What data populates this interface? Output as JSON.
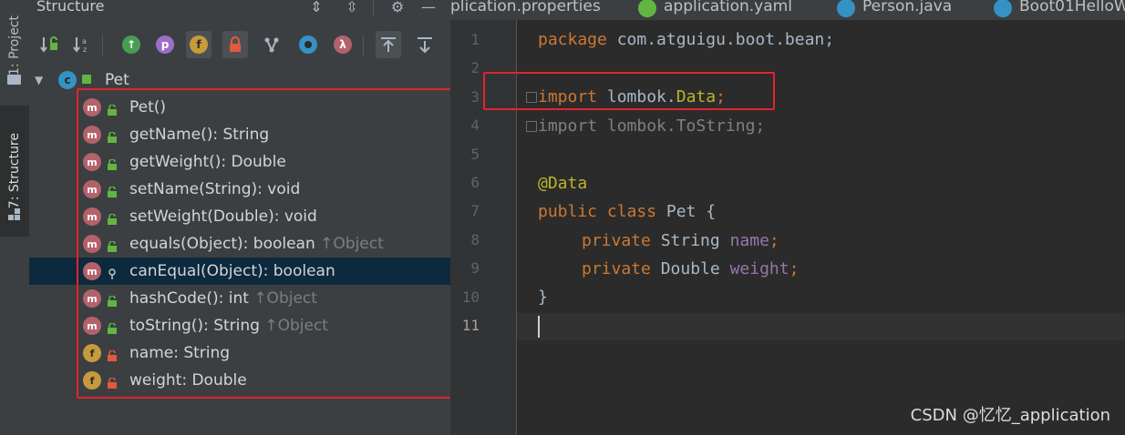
{
  "tool_strip": {
    "project_tab": "1: Project",
    "structure_tab": "7: Structure"
  },
  "structure_panel": {
    "title": "Structure",
    "header_buttons": [
      "expand-all-icon",
      "collapse-all-icon",
      "gear-icon",
      "hide-icon"
    ],
    "toolbar": [
      "sort-by-visibility",
      "sort-alphabetically",
      "show-inherited",
      "show-properties",
      "show-fields",
      "show-non-public",
      "show-lambdas",
      "show-anonymous",
      "show-circle",
      "show-lambda",
      "autoscroll-to-source",
      "autoscroll-from-source"
    ],
    "root": {
      "label": "Pet",
      "icon": "class-icon"
    },
    "members": [
      {
        "kind": "m",
        "label": "Pet()",
        "inherited": "",
        "visibility": "public"
      },
      {
        "kind": "m",
        "label": "getName(): String",
        "inherited": "",
        "visibility": "public"
      },
      {
        "kind": "m",
        "label": "getWeight(): Double",
        "inherited": "",
        "visibility": "public"
      },
      {
        "kind": "m",
        "label": "setName(String): void",
        "inherited": "",
        "visibility": "public"
      },
      {
        "kind": "m",
        "label": "setWeight(Double): void",
        "inherited": "",
        "visibility": "public"
      },
      {
        "kind": "m",
        "label": "equals(Object): boolean",
        "inherited": "↑Object",
        "visibility": "public"
      },
      {
        "kind": "m",
        "label": "canEqual(Object): boolean",
        "inherited": "",
        "visibility": "protected"
      },
      {
        "kind": "m",
        "label": "hashCode(): int",
        "inherited": "↑Object",
        "visibility": "public"
      },
      {
        "kind": "m",
        "label": "toString(): String",
        "inherited": "↑Object",
        "visibility": "public"
      },
      {
        "kind": "f",
        "label": "name: String",
        "inherited": "",
        "visibility": "private"
      },
      {
        "kind": "f",
        "label": "weight: Double",
        "inherited": "",
        "visibility": "private"
      }
    ]
  },
  "editor": {
    "tabs": [
      "plication.properties",
      "application.yaml",
      "Person.java",
      "Boot01HelloW"
    ],
    "line_numbers": [
      "1",
      "2",
      "3",
      "4",
      "5",
      "6",
      "7",
      "8",
      "9",
      "10",
      "11"
    ],
    "code": {
      "l1_kw": "package",
      "l1_rest": " com.atguigu.boot.bean;",
      "l3_kw": "import",
      "l3_pkg": " lombok.",
      "l3_cls": "Data",
      "l3_semi": ";",
      "l4": "import lombok.ToString;",
      "l6": "@Data",
      "l7_kw": "public class",
      "l7_rest": " Pet {",
      "l8_kw": "private",
      "l8_type": " String ",
      "l8_field": "name",
      "l8_semi": ";",
      "l9_kw": "private",
      "l9_type": " Double ",
      "l9_field": "weight",
      "l9_semi": ";",
      "l10": "}"
    }
  },
  "watermark": "CSDN @忆忆_application",
  "colors": {
    "highlight_box": "#e0242e",
    "selection": "#0d293e",
    "keyword": "#cc7832",
    "annotation": "#bbb529",
    "field": "#9876aa"
  }
}
